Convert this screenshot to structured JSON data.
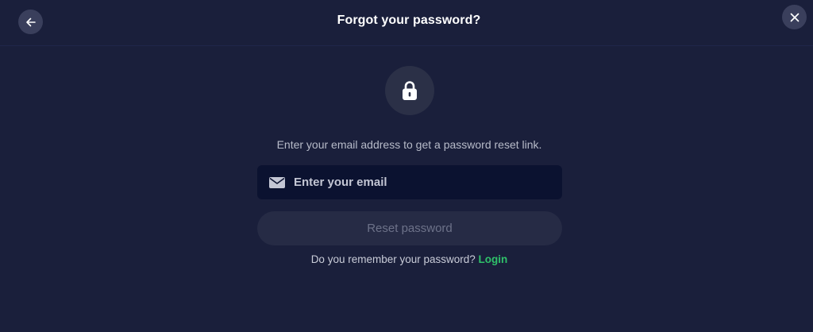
{
  "header": {
    "title": "Forgot your password?",
    "back_icon": "arrow-left-icon",
    "close_icon": "close-icon"
  },
  "lock_icon": "lock-icon",
  "description": "Enter your email address to get a password reset link.",
  "email": {
    "icon": "mail-icon",
    "placeholder": "Enter your email",
    "value": ""
  },
  "reset_button": {
    "label": "Reset password",
    "state": "disabled"
  },
  "footer": {
    "question": "Do you remember your password?",
    "login_label": "Login"
  },
  "colors": {
    "background": "#1a1f3b",
    "input_background": "#0b1230",
    "button_disabled": "#262b45",
    "link": "#2fc16a"
  }
}
